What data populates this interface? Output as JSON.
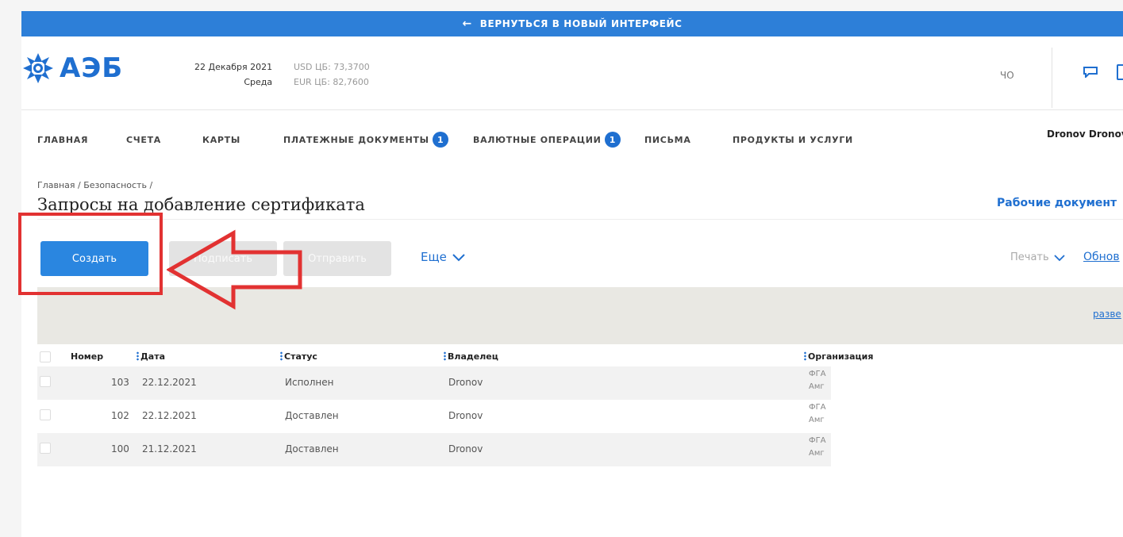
{
  "banner": {
    "arrow": "←",
    "text": "ВЕРНУТЬСЯ В НОВЫЙ ИНТЕРФЕЙС"
  },
  "header": {
    "logo_text": "АЭБ",
    "date": "22 Декабря 2021",
    "weekday": "Среда",
    "usd": "USD ЦБ: 73,3700",
    "eur": "EUR ЦБ: 82,7600",
    "right_label": "ЧО",
    "user": "Dronov Dronov"
  },
  "nav": {
    "items": [
      {
        "label": "ГЛАВНАЯ"
      },
      {
        "label": "СЧЕТА"
      },
      {
        "label": "КАРТЫ"
      },
      {
        "label": "ПЛАТЕЖНЫЕ ДОКУМЕНТЫ",
        "badge": "1"
      },
      {
        "label": "ВАЛЮТНЫЕ ОПЕРАЦИИ",
        "badge": "1"
      },
      {
        "label": "ПИСЬМА"
      },
      {
        "label": "ПРОДУКТЫ И УСЛУГИ"
      }
    ]
  },
  "page": {
    "breadcrumb": "Главная / Безопасность /",
    "title": "Запросы на добавление сертификата",
    "work_docs_link": "Рабочие документ"
  },
  "toolbar": {
    "create": "Создать",
    "sign": "Подписать",
    "send": "Отправить",
    "more": "Еще",
    "print": "Печать",
    "refresh": "Обнов"
  },
  "filter": {
    "expand": "разве"
  },
  "table": {
    "columns": [
      "Номер",
      "Дата",
      "Статус",
      "Владелец",
      "Организация"
    ],
    "rows": [
      {
        "number": "103",
        "date": "22.12.2021",
        "status": "Исполнен",
        "owner": "Dronov",
        "org_line1": "ФГА",
        "org_line2": "Амг"
      },
      {
        "number": "102",
        "date": "22.12.2021",
        "status": "Доставлен",
        "owner": "Dronov",
        "org_line1": "ФГА",
        "org_line2": "Амг"
      },
      {
        "number": "100",
        "date": "21.12.2021",
        "status": "Доставлен",
        "owner": "Dronov",
        "org_line1": "ФГА",
        "org_line2": "Амг"
      }
    ]
  },
  "colors": {
    "brand": "#1f6fd0",
    "banner": "#2d7fd8",
    "primary_button": "#2a86e0",
    "highlight": "#e23232"
  }
}
